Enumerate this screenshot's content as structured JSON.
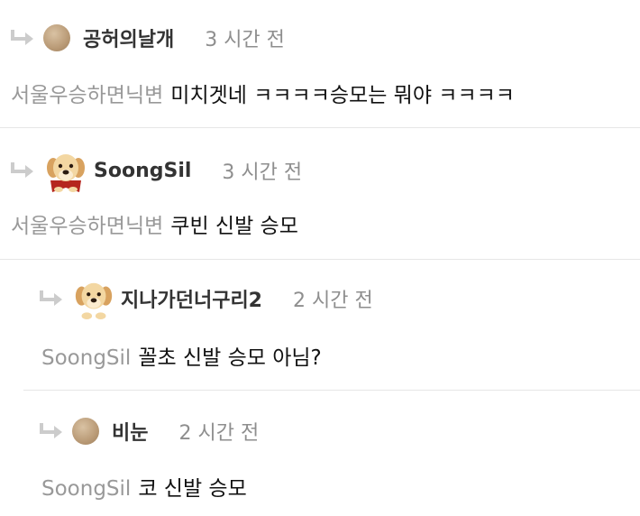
{
  "comments": [
    {
      "nickname": "공허의날개",
      "time": "3 시간 전",
      "mention": "서울우승하면닉변",
      "text": "미치겟네 ㅋㅋㅋㅋ승모는 뭐야 ㅋㅋㅋㅋ",
      "avatar": "plain-tan-circle"
    },
    {
      "nickname": "SoongSil",
      "time": "3 시간 전",
      "mention": "서울우승하면닉변",
      "text": "쿠빈 신발 승모",
      "avatar": "puppy-with-red-cape"
    },
    {
      "nickname": "지나가던너구리2",
      "time": "2 시간 전",
      "mention": "SoongSil",
      "text": "꼴초 신발 승모 아님?",
      "avatar": "puppy"
    },
    {
      "nickname": "비눈",
      "time": "2 시간 전",
      "mention": "SoongSil",
      "text": "코 신발 승모",
      "avatar": "plain-tan-circle"
    }
  ],
  "colors": {
    "nickname": "#333333",
    "time": "#8e8e8e",
    "mention": "#999999",
    "text": "#111111",
    "divider": "#e6e6e6",
    "reply_arrow": "#cccccc"
  }
}
